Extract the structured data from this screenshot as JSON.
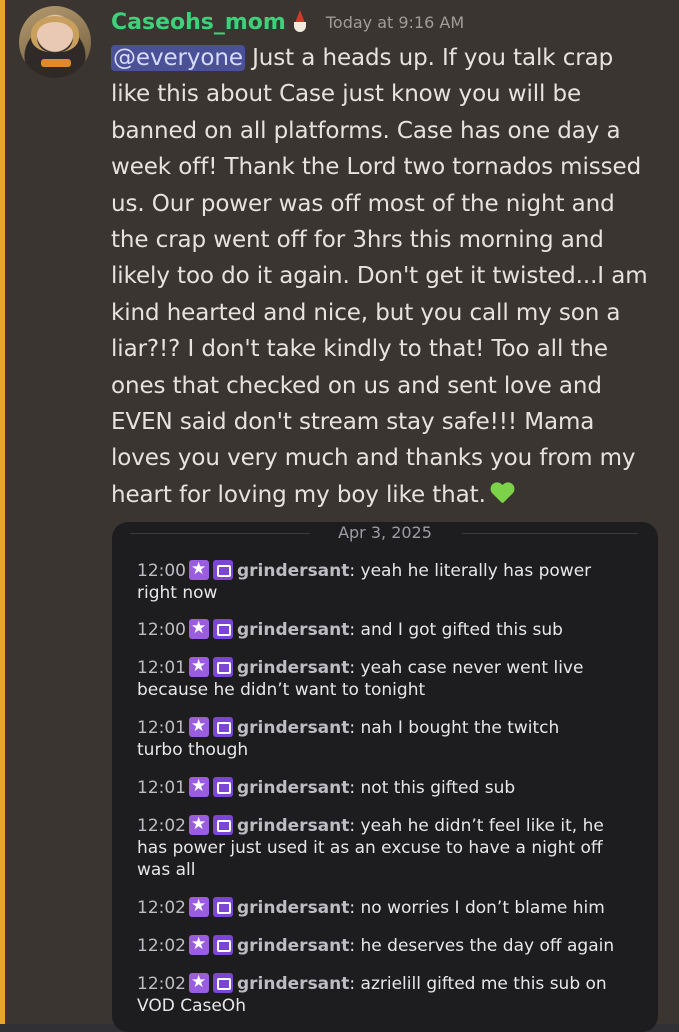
{
  "post": {
    "username": "Caseohs_mom",
    "timestamp": "Today at 9:16 AM",
    "mention": "@everyone",
    "message_lines": [
      " Just a heads up. If you talk crap",
      "like this about Case just know you will be",
      "banned on all platforms.  Case has one day a",
      "week off! Thank the Lord two tornados missed",
      "us.  Our power was off most of the night and",
      "the crap went off for 3hrs this morning and",
      "likely too do it again.  Don't get it twisted...I am",
      "kind hearted and nice, but you call my son a",
      "liar?!? I don't take kindly to that! Too all the",
      "ones that checked on us and sent love and",
      "EVEN said don't stream stay safe!!! Mama",
      "loves you very much and thanks you from my",
      "heart for loving my boy like that."
    ],
    "emoji": "green-heart-icon",
    "accent_color": "#e8a52c",
    "username_color": "#3fd17a"
  },
  "embed": {
    "date": "Apr 3, 2025",
    "messages": [
      {
        "time": "12:00",
        "user": "grindersant",
        "text": ": yeah he literally has power",
        "wrap": "right now"
      },
      {
        "time": "12:00",
        "user": "grindersant",
        "text": ": and I got gifted this sub",
        "wrap": ""
      },
      {
        "time": "12:01",
        "user": "grindersant",
        "text": ": yeah case never went live",
        "wrap": "because he didn’t want to tonight"
      },
      {
        "time": "12:01",
        "user": "grindersant",
        "text": ": nah I bought the twitch",
        "wrap": "turbo though"
      },
      {
        "time": "12:01",
        "user": "grindersant",
        "text": ": not this gifted sub",
        "wrap": ""
      },
      {
        "time": "12:02",
        "user": "grindersant",
        "text": ": yeah he didn’t feel like it, he",
        "wrap": "has power just used it as an excuse to have a night off",
        "wrap2": "was all"
      },
      {
        "time": "12:02",
        "user": "grindersant",
        "text": ": no worries I don’t blame him",
        "wrap": ""
      },
      {
        "time": "12:02",
        "user": "grindersant",
        "text": ": he deserves the day off again",
        "wrap": ""
      },
      {
        "time": "12:02",
        "user": "grindersant",
        "text": ": azrielill gifted me this sub on",
        "wrap": "VOD CaseOh"
      }
    ]
  }
}
